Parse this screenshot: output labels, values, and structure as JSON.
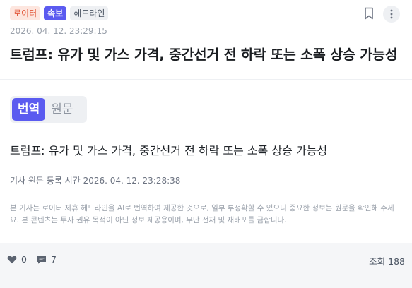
{
  "tags": {
    "source": "로이터",
    "breaking": "속보",
    "category": "헤드라인"
  },
  "timestamp": "2026. 04. 12. 23:29:15",
  "headline": "트럼프: 유가 및 가스 가격, 중간선거 전 하락 또는 소폭 상승 가능성",
  "toggle": {
    "translation": "번역",
    "original": "원문",
    "selected": "번역"
  },
  "body_text": "트럼프: 유가 및 가스 가격, 중간선거 전 하락 또는 소폭 상승 가능성",
  "registered_time": "기사 원문 등록 시간 2026. 04. 12. 23:28:38",
  "disclaimer": "본 기사는 로이터 제휴 헤드라인을 AI로 번역하여 제공한 것으로, 일부 부정확할 수 있으니 중요한 정보는 원문을 확인해 주세요. 본 콘텐츠는 투자 권유 목적이 아닌 정보 제공용이며, 무단 전재 및 재배포를 금합니다.",
  "footer": {
    "likes": "0",
    "comments": "7",
    "views": "조회 188"
  },
  "icons": {
    "bookmark": "bookmark-icon",
    "more": "more-vertical-icon",
    "like": "heart-icon",
    "comment": "comment-icon"
  },
  "colors": {
    "accent": "#5b5bf0",
    "source_tag_bg": "#fde6df",
    "source_tag_text": "#e2583a"
  }
}
